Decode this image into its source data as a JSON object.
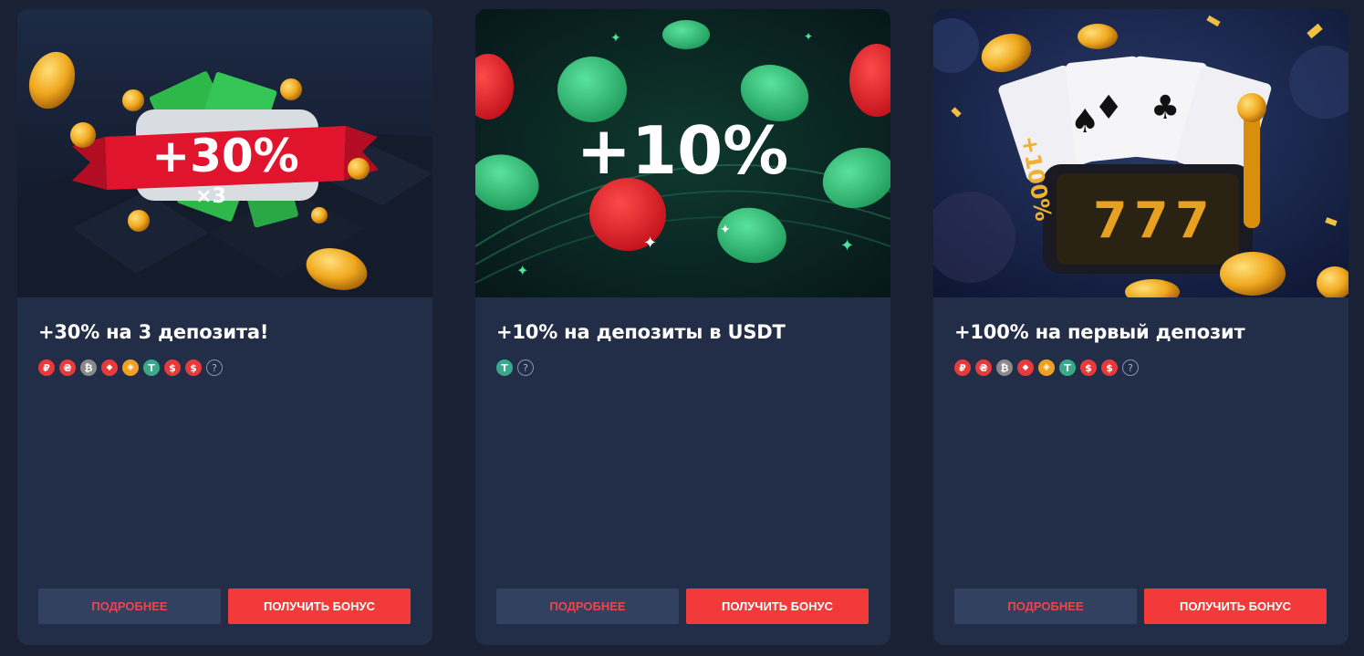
{
  "colors": {
    "page_bg": "#1a2134",
    "card_bg": "#222e48",
    "more_button_bg": "#334161",
    "more_button_text": "#e5484d",
    "get_button_bg": "#f23a3a"
  },
  "cards": [
    {
      "banner_text": "+30%",
      "banner_sub": "×3",
      "title": "+30% на 3 депозита!",
      "currencies": [
        {
          "icon": "ruble-icon",
          "glyph": "₽",
          "color": "#e83a3a"
        },
        {
          "icon": "hryvnia-icon",
          "glyph": "₴",
          "color": "#e83a3a"
        },
        {
          "icon": "bitcoin-icon",
          "glyph": "₿",
          "color": "#8a8a8a"
        },
        {
          "icon": "tron-icon",
          "glyph": "◆",
          "color": "#e83a3a"
        },
        {
          "icon": "bnb-icon",
          "glyph": "◈",
          "color": "#f0a020"
        },
        {
          "icon": "tether-icon",
          "glyph": "T",
          "color": "#3aa88a"
        },
        {
          "icon": "dollar-coin-icon",
          "glyph": "$",
          "color": "#e83a3a"
        },
        {
          "icon": "dollar-icon",
          "glyph": "$",
          "color": "#e83a3a"
        },
        {
          "icon": "question-icon",
          "glyph": "?",
          "color": ""
        }
      ],
      "more_label": "ПОДРОБНЕЕ",
      "get_label": "ПОЛУЧИТЬ БОНУС"
    },
    {
      "banner_text": "+10%",
      "title": "+10% на депозиты в USDT",
      "currencies": [
        {
          "icon": "tether-icon",
          "glyph": "T",
          "color": "#3aa88a"
        },
        {
          "icon": "question-icon",
          "glyph": "?",
          "color": ""
        }
      ],
      "more_label": "ПОДРОБНЕЕ",
      "get_label": "ПОЛУЧИТЬ БОНУС"
    },
    {
      "banner_text": "+100%",
      "title": "+100% на первый депозит",
      "currencies": [
        {
          "icon": "ruble-icon",
          "glyph": "₽",
          "color": "#e83a3a"
        },
        {
          "icon": "hryvnia-icon",
          "glyph": "₴",
          "color": "#e83a3a"
        },
        {
          "icon": "bitcoin-icon",
          "glyph": "₿",
          "color": "#8a8a8a"
        },
        {
          "icon": "tron-icon",
          "glyph": "◆",
          "color": "#e83a3a"
        },
        {
          "icon": "bnb-icon",
          "glyph": "◈",
          "color": "#f0a020"
        },
        {
          "icon": "tether-icon",
          "glyph": "T",
          "color": "#3aa88a"
        },
        {
          "icon": "dollar-coin-icon",
          "glyph": "$",
          "color": "#e83a3a"
        },
        {
          "icon": "dollar-icon",
          "glyph": "$",
          "color": "#e83a3a"
        },
        {
          "icon": "question-icon",
          "glyph": "?",
          "color": ""
        }
      ],
      "more_label": "ПОДРОБНЕЕ",
      "get_label": "ПОЛУЧИТЬ БОНУС"
    }
  ]
}
